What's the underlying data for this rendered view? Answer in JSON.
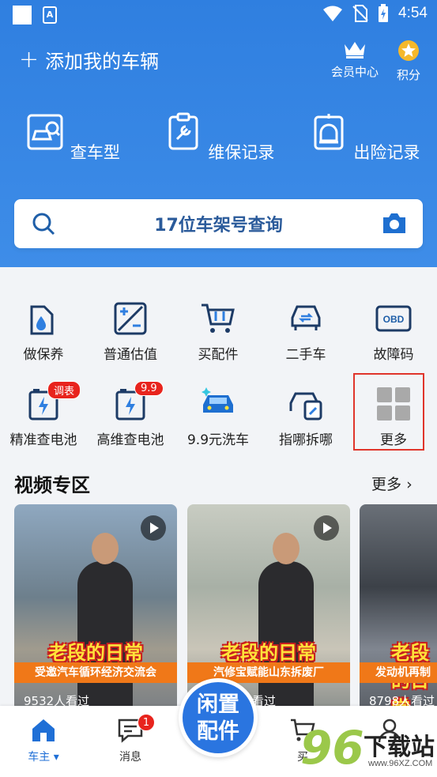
{
  "status": {
    "time": "4:54"
  },
  "header": {
    "add_car": "添加我的车辆",
    "vip_label": "会员中心",
    "points_label": "积分"
  },
  "quick_nav": [
    {
      "label": "查车型",
      "icon": "car-search-icon"
    },
    {
      "label": "维保记录",
      "icon": "maintenance-icon"
    },
    {
      "label": "出险记录",
      "icon": "accident-icon"
    }
  ],
  "search": {
    "placeholder": "17位车架号查询"
  },
  "grid": [
    {
      "label": "做保养",
      "icon": "oil-icon"
    },
    {
      "label": "普通估值",
      "icon": "valuation-icon"
    },
    {
      "label": "买配件",
      "icon": "cart-icon"
    },
    {
      "label": "二手车",
      "icon": "used-car-icon"
    },
    {
      "label": "故障码",
      "icon": "obd-icon",
      "icon_text": "OBD"
    },
    {
      "label": "精准查电池",
      "icon": "battery-icon",
      "badge": "调表"
    },
    {
      "label": "高维查电池",
      "icon": "battery-icon",
      "badge": "9.9"
    },
    {
      "label": "9.9元洗车",
      "icon": "car-wash-icon"
    },
    {
      "label": "指哪拆哪",
      "icon": "repair-icon"
    },
    {
      "label": "更多",
      "icon": "more-grid-icon"
    }
  ],
  "video_section": {
    "title": "视频专区",
    "more": "更多",
    "videos": [
      {
        "title": "老段的日常",
        "subtitle": "受邀汽车循环经济交流会",
        "views": "9532人看过"
      },
      {
        "title": "老段的日常",
        "subtitle": "汽修宝赋能山东拆废厂",
        "views": "看过"
      },
      {
        "title": "老段的日常",
        "subtitle": "发动机再制",
        "views": "8798人看过"
      }
    ]
  },
  "bottom_nav": {
    "home": "车主",
    "messages": "消息",
    "messages_badge": "1",
    "center_line1": "闲置",
    "center_line2": "配件",
    "buy": "买"
  },
  "watermark": {
    "num": "96",
    "text": "下载站",
    "url": "www.96XZ.COM"
  },
  "colors": {
    "primary": "#2f7fe0",
    "badge": "#e8241d",
    "highlight_box": "#e0352b"
  }
}
